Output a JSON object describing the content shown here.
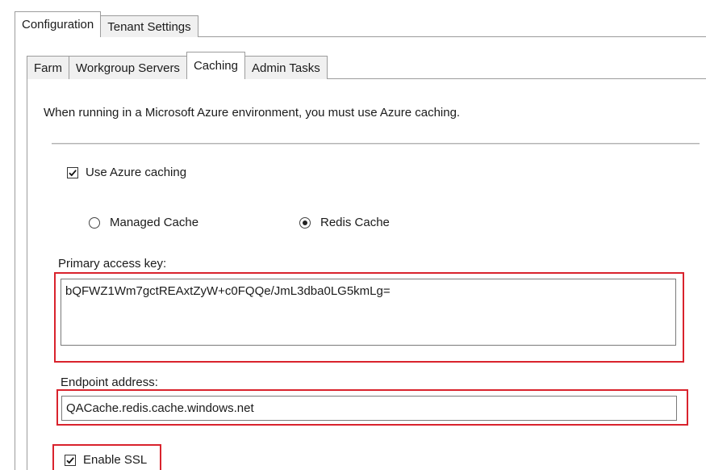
{
  "outer_tabs": [
    {
      "label": "Configuration",
      "active": true
    },
    {
      "label": "Tenant Settings",
      "active": false
    }
  ],
  "inner_tabs": [
    {
      "label": "Farm",
      "active": false
    },
    {
      "label": "Workgroup Servers",
      "active": false
    },
    {
      "label": "Caching",
      "active": true
    },
    {
      "label": "Admin Tasks",
      "active": false
    }
  ],
  "caching": {
    "notice": "When running in a Microsoft Azure environment, you must use Azure caching.",
    "use_azure_caching": {
      "label": "Use Azure caching",
      "checked": true
    },
    "cache_type": {
      "options": [
        "Managed Cache",
        "Redis Cache"
      ],
      "selected": "Redis Cache"
    },
    "primary_access_key": {
      "label": "Primary access key:",
      "value": "bQFWZ1Wm7gctREAxtZyW+c0FQQe/JmL3dba0LG5kmLg="
    },
    "endpoint_address": {
      "label": "Endpoint address:",
      "value": "QACache.redis.cache.windows.net"
    },
    "enable_ssl": {
      "label": "Enable SSL",
      "checked": true
    }
  },
  "colors": {
    "highlight": "#d9232d",
    "tab_border": "#9c9c9c",
    "inactive_tab_bg": "#f0f0f0"
  }
}
